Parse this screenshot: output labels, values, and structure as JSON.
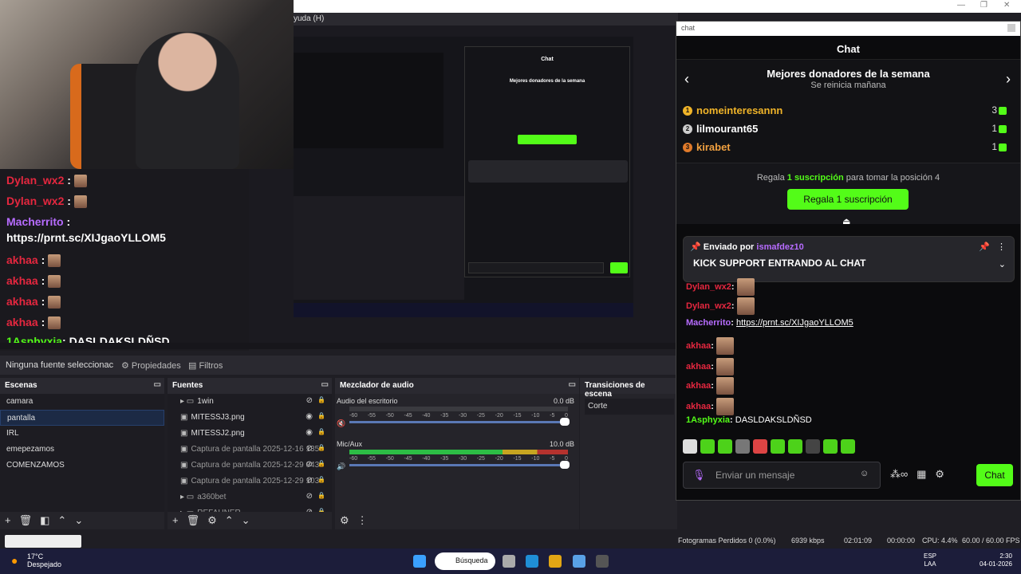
{
  "obs": {
    "menu_help": "yuda (H)",
    "source_toolbar": {
      "no_source": "Ninguna fuente seleccionac",
      "properties": "Propiedades",
      "filters": "Filtros"
    },
    "scenes": {
      "title": "Escenas",
      "items": [
        "camara",
        "pantalla",
        "IRL",
        "emepezamos",
        "COMENZAMOS"
      ],
      "selected": "pantalla"
    },
    "sources": {
      "title": "Fuentes",
      "items": [
        {
          "label": "1win",
          "icon": "folder-icon"
        },
        {
          "label": "MITESSJ3.png",
          "icon": "image-icon"
        },
        {
          "label": "MITESSJ2.png",
          "icon": "image-icon"
        },
        {
          "label": "Captura de pantalla 2025-12-16 135",
          "icon": "image-icon"
        },
        {
          "label": "Captura de pantalla 2025-12-29 043",
          "icon": "image-icon"
        },
        {
          "label": "Captura de pantalla 2025-12-29 103",
          "icon": "image-icon"
        },
        {
          "label": "a360bet",
          "icon": "folder-icon"
        },
        {
          "label": "REFAHNER",
          "icon": "folder-icon"
        }
      ]
    },
    "mixer": {
      "title": "Mezclador de audio",
      "channels": [
        {
          "name": "Audio del escritorio",
          "db": "0.0 dB",
          "level": 0.0,
          "muted": true
        },
        {
          "name": "Mic/Aux",
          "db": "10.0 dB",
          "level": 0.98,
          "muted": false
        }
      ],
      "ticks": [
        "-60",
        "-55",
        "-50",
        "-45",
        "-40",
        "-35",
        "-30",
        "-25",
        "-20",
        "-15",
        "-10",
        "-5",
        "0"
      ]
    },
    "transitions": {
      "title": "Transiciones de escena",
      "selected": "Corte"
    },
    "status": {
      "dropped": "Fotogramas Perdidos 0 (0.0%)",
      "kbps": "6939 kbps",
      "stream_time": "02:01:09",
      "rec_time": "00:00:00",
      "cpu": "CPU: 4.4%",
      "fps": "60.00 / 60.00 FPS"
    }
  },
  "overlay_chat": [
    {
      "user": "Dylan_wx2",
      "color": "red",
      "emote": true
    },
    {
      "user": "Dylan_wx2",
      "color": "red",
      "emote": true
    },
    {
      "user": "Macherrito",
      "color": "purple",
      "emote": false
    },
    {
      "user": "https://prnt.sc/XIJgaoYLLOM5",
      "color": "white",
      "emote": false
    },
    {
      "user": "akhaa",
      "color": "red",
      "emote": true
    },
    {
      "user": "akhaa",
      "color": "red",
      "emote": true
    },
    {
      "user": "akhaa",
      "color": "red",
      "emote": true
    },
    {
      "user": "akhaa",
      "color": "red",
      "emote": true
    },
    {
      "user": "1Asphyxia",
      "color": "green",
      "text": ": DASLDAKSLDÑSD"
    }
  ],
  "chat": {
    "window_title": "chat",
    "header": "Chat",
    "donors": {
      "title": "Mejores donadores de la semana",
      "subtitle": "Se reinicia mañana",
      "list": [
        {
          "rank": "1",
          "name": "nomeinteresannn",
          "count": "3",
          "color": "#f0b429"
        },
        {
          "rank": "2",
          "name": "lilmourant65",
          "count": "1",
          "color": "#ffffff"
        },
        {
          "rank": "3",
          "name": "kirabet",
          "count": "1",
          "color": "#f0a040"
        }
      ]
    },
    "gift": {
      "text_pre": "Regala",
      "text_bold": "1 suscripción",
      "text_post": "para tomar la posición 4",
      "button": "Regala 1 suscripción"
    },
    "pinned": {
      "by_label": "Enviado por",
      "user": "ismafdez10",
      "text": "KICK SUPPORT ENTRANDO AL CHAT"
    },
    "messages": [
      {
        "user": "Dylan_wx2",
        "color": "#e5273f",
        "text": ""
      },
      {
        "user": "Dylan_wx2",
        "color": "#e5273f",
        "text": ""
      },
      {
        "user": "Macherrito",
        "color": "#b76cff",
        "text": "https://prnt.sc/XIJgaoYLLOM5"
      },
      {
        "user": "akhaa",
        "color": "#e5273f",
        "text": ""
      },
      {
        "user": "akhaa",
        "color": "#e5273f",
        "text": ""
      },
      {
        "user": "akhaa",
        "color": "#e5273f",
        "text": ""
      },
      {
        "user": "akhaa",
        "color": "#e5273f",
        "text": ""
      },
      {
        "user": "1Asphyxia",
        "color": "#53fc18",
        "text": "DASLDAKSLDÑSD"
      }
    ],
    "input_placeholder": "Enviar un mensaje",
    "send_label": "Chat",
    "accent": "#53fc18"
  },
  "taskbar": {
    "temp": "17°C",
    "weather": "Despejado",
    "search": "Búsqueda",
    "lang1": "ESP",
    "lang2": "LAA",
    "time": "2:30",
    "date": "04-01-2026"
  }
}
